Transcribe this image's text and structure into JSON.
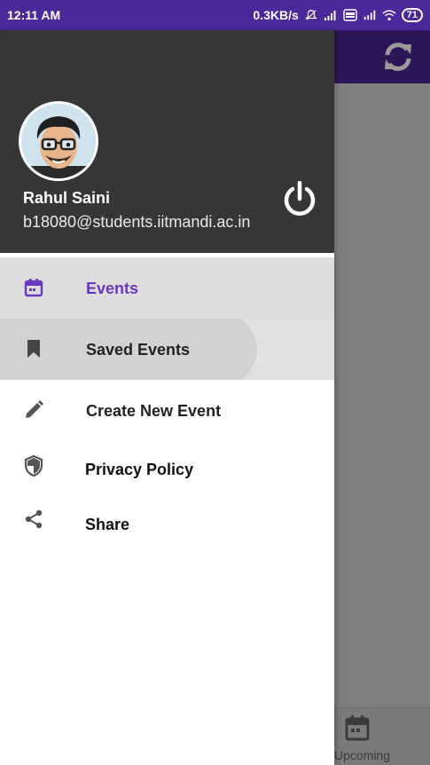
{
  "status_bar": {
    "time": "12:11 AM",
    "network_speed": "0.3KB/s",
    "battery": "71",
    "icons": [
      "mute-icon",
      "signal-icon",
      "volte-icon",
      "4g-signal-icon",
      "wifi-icon",
      "battery-icon"
    ]
  },
  "background_app": {
    "toolbar_icon": "refresh-icon",
    "bottom_nav_label": "Upcoming",
    "bottom_nav_icon": "calendar-icon"
  },
  "drawer": {
    "user": {
      "name": "Rahul Saini",
      "email": "b18080@students.iitmandi.ac.in"
    },
    "logout_icon": "power-icon",
    "items": [
      {
        "label": "Events",
        "icon": "calendar-icon",
        "selected": true
      },
      {
        "label": "Saved Events",
        "icon": "bookmark-icon",
        "pressed": true
      },
      {
        "label": "Create New Event",
        "icon": "pencil-icon"
      },
      {
        "label": "Privacy Policy",
        "icon": "shield-icon"
      },
      {
        "label": "Share",
        "icon": "share-icon"
      }
    ]
  },
  "colors": {
    "status_bar": "#4a2a9b",
    "accent": "#6a39c0",
    "header": "#363636",
    "toolbar": "#2d1657"
  }
}
